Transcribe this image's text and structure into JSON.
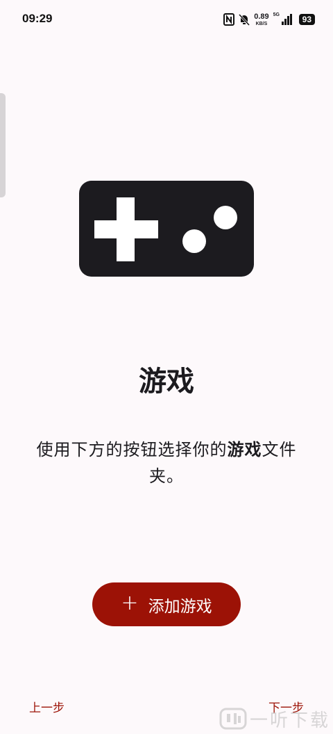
{
  "status_bar": {
    "time": "09:29",
    "net_speed_value": "0.89",
    "net_speed_unit": "KB/S",
    "network_type": "5G",
    "battery": "93"
  },
  "main": {
    "icon": "gamepad-icon",
    "title": "游戏",
    "description_before": "使用下方的按钮选择你的",
    "description_bold": "游戏",
    "description_after": "文件夹。",
    "add_button_icon": "plus-icon",
    "add_button_label": "添加游戏"
  },
  "footer": {
    "prev_label": "上一步",
    "next_label": "下一步"
  },
  "watermark": {
    "text": "一听下载"
  },
  "colors": {
    "accent": "#9c1206",
    "background": "#fdf9fb",
    "icon": "#1c1b1f"
  }
}
